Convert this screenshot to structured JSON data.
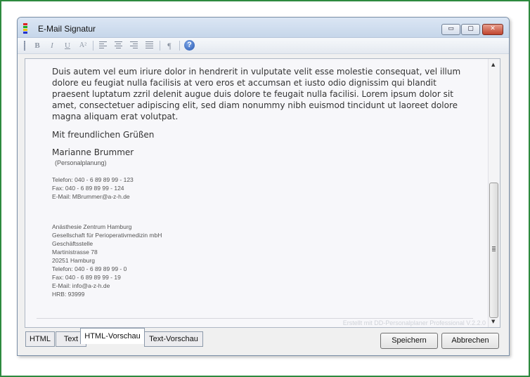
{
  "window": {
    "title": "E-Mail Signatur"
  },
  "titlebar_buttons": {
    "minimize": "▭",
    "maximize": "▢",
    "close": "✕"
  },
  "toolbar": {
    "bold": "B",
    "italic": "I",
    "underline": "U",
    "font_size": "A²",
    "paragraph": "¶",
    "help": "?"
  },
  "document": {
    "body_text": "Duis autem vel eum iriure dolor in hendrerit in vulputate velit esse molestie consequat, vel illum dolore eu feugiat nulla facilisis at vero eros et accumsan et iusto odio dignissim qui blandit praesent luptatum zzril delenit augue duis dolore te feugait nulla facilisi. Lorem ipsum dolor sit amet, consectetuer adipiscing elit, sed diam nonummy nibh euismod tincidunt ut laoreet dolore magna aliquam erat volutpat.",
    "greeting": "Mit freundlichen Grüßen",
    "name": "Marianne Brummer",
    "department": "(Personalplanung)",
    "contact_lines": [
      "Telefon: 040 - 6 89 89 99 - 123",
      "Fax: 040 - 6 89 89 99 - 124",
      "E-Mail: MBrummer@a-z-h.de"
    ],
    "company_lines": [
      "Anästhesie Zentrum Hamburg",
      "Gesellschaft für Perioperativmedizin mbH",
      "Geschäftsstelle",
      "Martinistrasse 78",
      "20251 Hamburg",
      "Telefon: 040 - 6 89 89 99 - 0",
      "Fax: 040 - 6 89 89 99 - 19",
      "E-Mail: info@a-z-h.de",
      "HRB: 93999"
    ],
    "footer_stamp": "Erstellt mit DD-Personalplaner Professional V.2.2.0"
  },
  "tabs": [
    {
      "label": "HTML"
    },
    {
      "label": "Text"
    },
    {
      "label": "HTML-Vorschau"
    },
    {
      "label": "Text-Vorschau"
    }
  ],
  "buttons": {
    "save": "Speichern",
    "cancel": "Abbrechen"
  }
}
